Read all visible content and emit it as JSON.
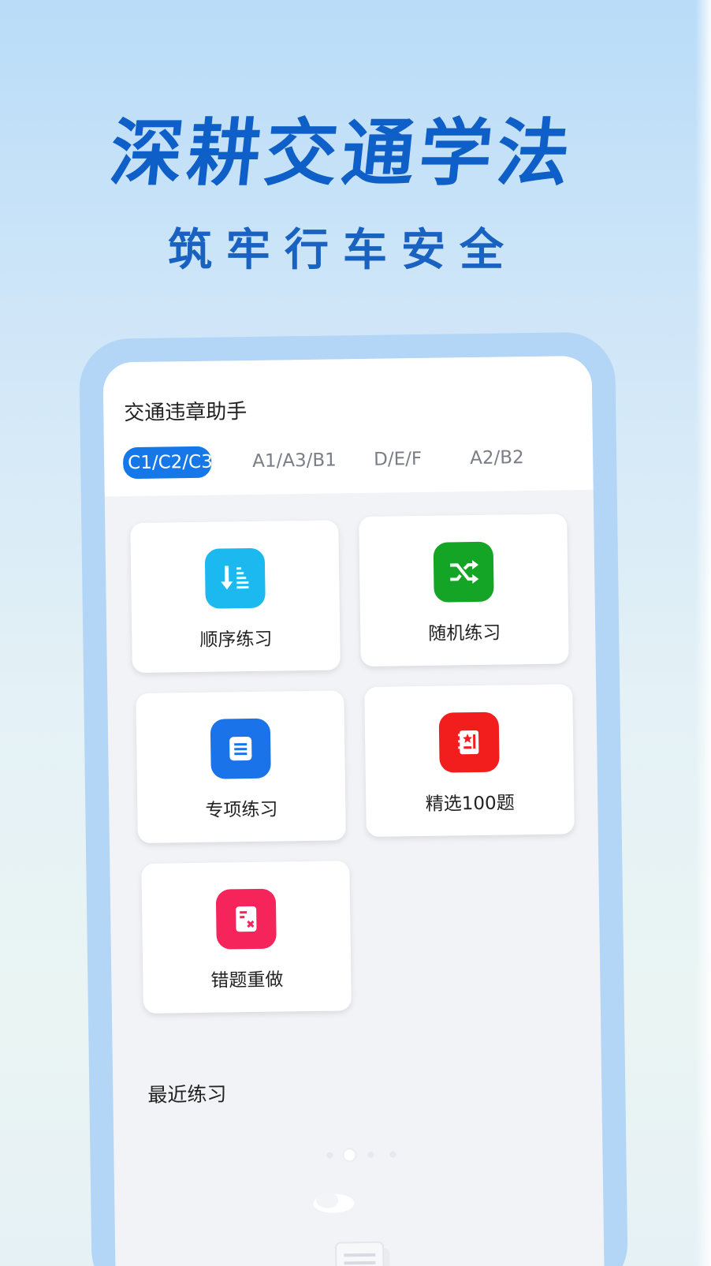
{
  "hero": {
    "title": "深耕交通学法",
    "subtitle": "筑牢行车安全"
  },
  "app": {
    "title": "交通违章助手",
    "tabs": [
      {
        "label": "C1/C2/C3",
        "active": true
      },
      {
        "label": "A1/A3/B1",
        "active": false
      },
      {
        "label": "D/E/F",
        "active": false
      },
      {
        "label": "A2/B2",
        "active": false
      }
    ],
    "cards": [
      {
        "label": "顺序练习",
        "icon": "sort-list-icon",
        "color": "#1bb9f0"
      },
      {
        "label": "随机练习",
        "icon": "shuffle-icon",
        "color": "#14a526"
      },
      {
        "label": "专项练习",
        "icon": "document-list-icon",
        "color": "#1a73e8"
      },
      {
        "label": "精选100题",
        "icon": "star-notebook-icon",
        "color": "#f21d1d"
      },
      {
        "label": "错题重做",
        "icon": "wrong-answer-icon",
        "color": "#f5245a"
      }
    ],
    "recent_title": "最近练习",
    "pager": {
      "total": 4,
      "active": 2
    }
  },
  "colors": {
    "brand_blue": "#0f5fc8",
    "tab_active": "#1677e8",
    "frame": "#b3d6f7"
  }
}
